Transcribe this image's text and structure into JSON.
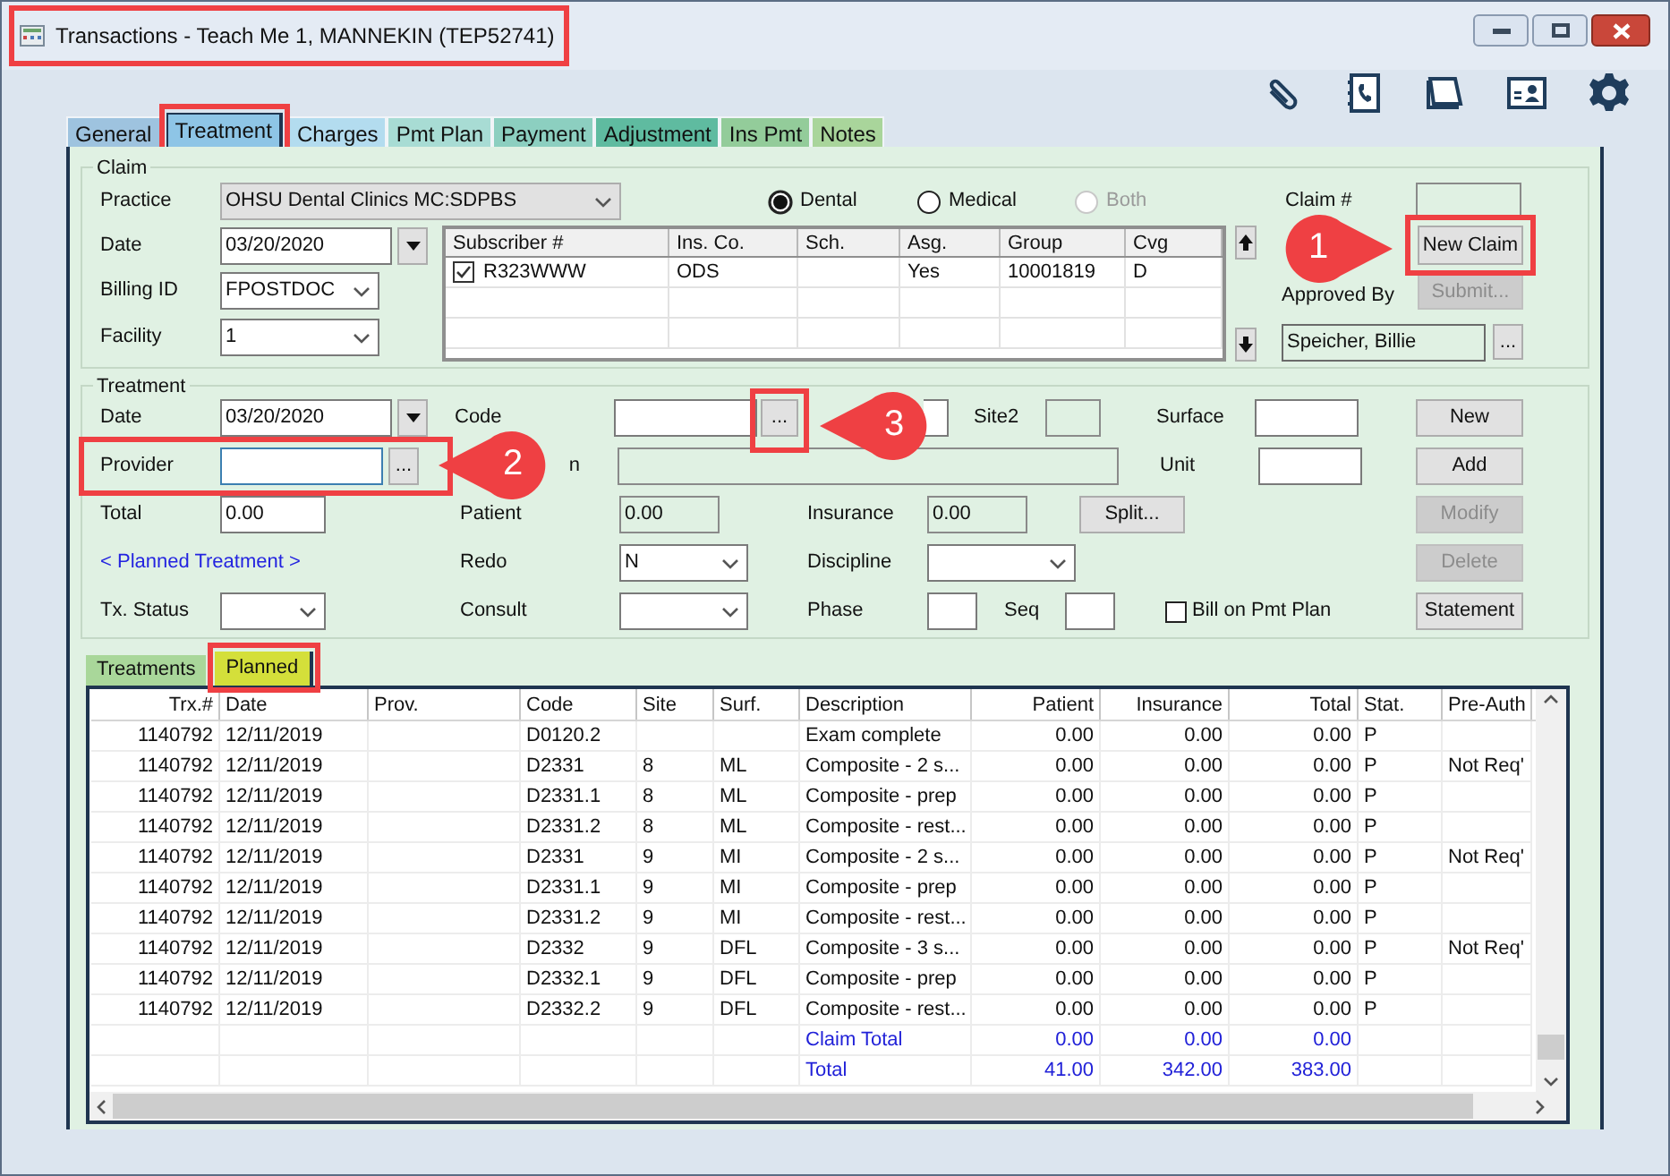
{
  "window": {
    "title": "Transactions - Teach Me 1, MANNEKIN (TEP52741)"
  },
  "tabs": [
    {
      "label": "General",
      "selected": false,
      "color": "#9ec3df"
    },
    {
      "label": "Treatment",
      "selected": true,
      "color": "#8ec5e6"
    },
    {
      "label": "Charges",
      "selected": false,
      "color": "#b3dcef"
    },
    {
      "label": "Pmt Plan",
      "selected": false,
      "color": "#a8dcd4"
    },
    {
      "label": "Payment",
      "selected": false,
      "color": "#8ccfc0"
    },
    {
      "label": "Adjustment",
      "selected": false,
      "color": "#5fbba0"
    },
    {
      "label": "Ins Pmt",
      "selected": false,
      "color": "#93cc9a"
    },
    {
      "label": "Notes",
      "selected": false,
      "color": "#a9d59b"
    }
  ],
  "claim": {
    "legend": "Claim",
    "practice": {
      "label": "Practice",
      "value": "OHSU Dental Clinics MC:SDPBS"
    },
    "claim_types": [
      {
        "label": "Dental",
        "selected": true,
        "disabled": false
      },
      {
        "label": "Medical",
        "selected": false,
        "disabled": false
      },
      {
        "label": "Both",
        "selected": false,
        "disabled": true
      }
    ],
    "claim_number": {
      "label": "Claim #"
    },
    "date": {
      "label": "Date",
      "value": "03/20/2020"
    },
    "billing_id": {
      "label": "Billing ID",
      "value": "FPOSTDOC"
    },
    "facility": {
      "label": "Facility",
      "value": "1"
    },
    "subscribers": {
      "columns": [
        "Subscriber #",
        "Ins. Co.",
        "Sch.",
        "Asg.",
        "Group",
        "Cvg"
      ],
      "rows": [
        {
          "checked": true,
          "subscriber": "R323WWW",
          "ins_co": "ODS",
          "asg": "Yes",
          "group": "10001819",
          "cvg": "D"
        }
      ]
    },
    "new_claim": {
      "label": "New Claim",
      "disabled": false
    },
    "approved_by": {
      "label": "Approved By",
      "value": "Speicher, Billie",
      "browse": "..."
    },
    "submit": {
      "label": "Submit...",
      "disabled": true
    }
  },
  "treatment": {
    "legend": "Treatment",
    "date": {
      "label": "Date",
      "value": "03/20/2020"
    },
    "code": {
      "label": "Code",
      "browse": "..."
    },
    "site2": {
      "label": "Site2"
    },
    "surface": {
      "label": "Surface"
    },
    "provider": {
      "label": "Provider",
      "browse": "..."
    },
    "description_label_visible": "n",
    "unit": {
      "label": "Unit"
    },
    "total": {
      "label": "Total",
      "value": "0.00"
    },
    "patient": {
      "label": "Patient",
      "value": "0.00"
    },
    "insurance": {
      "label": "Insurance",
      "value": "0.00"
    },
    "split": "Split...",
    "planned_link": "< Planned Treatment >",
    "redo": {
      "label": "Redo",
      "value": "N"
    },
    "discipline": {
      "label": "Discipline"
    },
    "tx_status": {
      "label": "Tx. Status"
    },
    "consult": {
      "label": "Consult"
    },
    "phase": {
      "label": "Phase"
    },
    "seq": {
      "label": "Seq"
    },
    "bill_on_pmt_plan": {
      "label": "Bill on Pmt Plan",
      "checked": false
    },
    "buttons": [
      {
        "label": "New",
        "disabled": false
      },
      {
        "label": "Add",
        "disabled": false
      },
      {
        "label": "Modify",
        "disabled": true
      },
      {
        "label": "Delete",
        "disabled": true
      },
      {
        "label": "Statement",
        "disabled": false
      }
    ]
  },
  "sub_tabs": [
    {
      "label": "Treatments",
      "selected": false
    },
    {
      "label": "Planned",
      "selected": true
    }
  ],
  "table": {
    "columns": [
      "Trx.#",
      "Date",
      "Prov.",
      "Code",
      "Site",
      "Surf.",
      "Description",
      "Patient",
      "Insurance",
      "Total",
      "Stat.",
      "Pre-Auth"
    ],
    "rows": [
      {
        "kind": "item",
        "trx": "1140792",
        "date": "12/11/2019",
        "code": "D0120.2",
        "description": "Exam complete",
        "patient": "0.00",
        "insurance": "0.00",
        "total": "0.00",
        "stat": "P"
      },
      {
        "kind": "item",
        "trx": "1140792",
        "date": "12/11/2019",
        "code": "D2331",
        "site": "8",
        "surf": "ML",
        "description": "Composite - 2 s...",
        "patient": "0.00",
        "insurance": "0.00",
        "total": "0.00",
        "stat": "P",
        "pre_auth": "Not Req'"
      },
      {
        "kind": "item",
        "trx": "1140792",
        "date": "12/11/2019",
        "code": "D2331.1",
        "site": "8",
        "surf": "ML",
        "description": "Composite - prep",
        "patient": "0.00",
        "insurance": "0.00",
        "total": "0.00",
        "stat": "P"
      },
      {
        "kind": "item",
        "trx": "1140792",
        "date": "12/11/2019",
        "code": "D2331.2",
        "site": "8",
        "surf": "ML",
        "description": "Composite - rest...",
        "patient": "0.00",
        "insurance": "0.00",
        "total": "0.00",
        "stat": "P"
      },
      {
        "kind": "item",
        "trx": "1140792",
        "date": "12/11/2019",
        "code": "D2331",
        "site": "9",
        "surf": "MI",
        "description": "Composite - 2 s...",
        "patient": "0.00",
        "insurance": "0.00",
        "total": "0.00",
        "stat": "P",
        "pre_auth": "Not Req'"
      },
      {
        "kind": "item",
        "trx": "1140792",
        "date": "12/11/2019",
        "code": "D2331.1",
        "site": "9",
        "surf": "MI",
        "description": "Composite - prep",
        "patient": "0.00",
        "insurance": "0.00",
        "total": "0.00",
        "stat": "P"
      },
      {
        "kind": "item",
        "trx": "1140792",
        "date": "12/11/2019",
        "code": "D2331.2",
        "site": "9",
        "surf": "MI",
        "description": "Composite - rest...",
        "patient": "0.00",
        "insurance": "0.00",
        "total": "0.00",
        "stat": "P"
      },
      {
        "kind": "item",
        "trx": "1140792",
        "date": "12/11/2019",
        "code": "D2332",
        "site": "9",
        "surf": "DFL",
        "description": "Composite - 3 s...",
        "patient": "0.00",
        "insurance": "0.00",
        "total": "0.00",
        "stat": "P",
        "pre_auth": "Not Req'"
      },
      {
        "kind": "item",
        "trx": "1140792",
        "date": "12/11/2019",
        "code": "D2332.1",
        "site": "9",
        "surf": "DFL",
        "description": "Composite - prep",
        "patient": "0.00",
        "insurance": "0.00",
        "total": "0.00",
        "stat": "P"
      },
      {
        "kind": "item",
        "trx": "1140792",
        "date": "12/11/2019",
        "code": "D2332.2",
        "site": "9",
        "surf": "DFL",
        "description": "Composite - rest...",
        "patient": "0.00",
        "insurance": "0.00",
        "total": "0.00",
        "stat": "P"
      },
      {
        "kind": "total",
        "description": "Claim Total",
        "patient": "0.00",
        "insurance": "0.00",
        "total": "0.00"
      },
      {
        "kind": "total",
        "description": "Total",
        "patient": "41.00",
        "insurance": "342.00",
        "total": "383.00"
      }
    ]
  },
  "callouts": [
    {
      "number": "1"
    },
    {
      "number": "2"
    },
    {
      "number": "3"
    }
  ]
}
